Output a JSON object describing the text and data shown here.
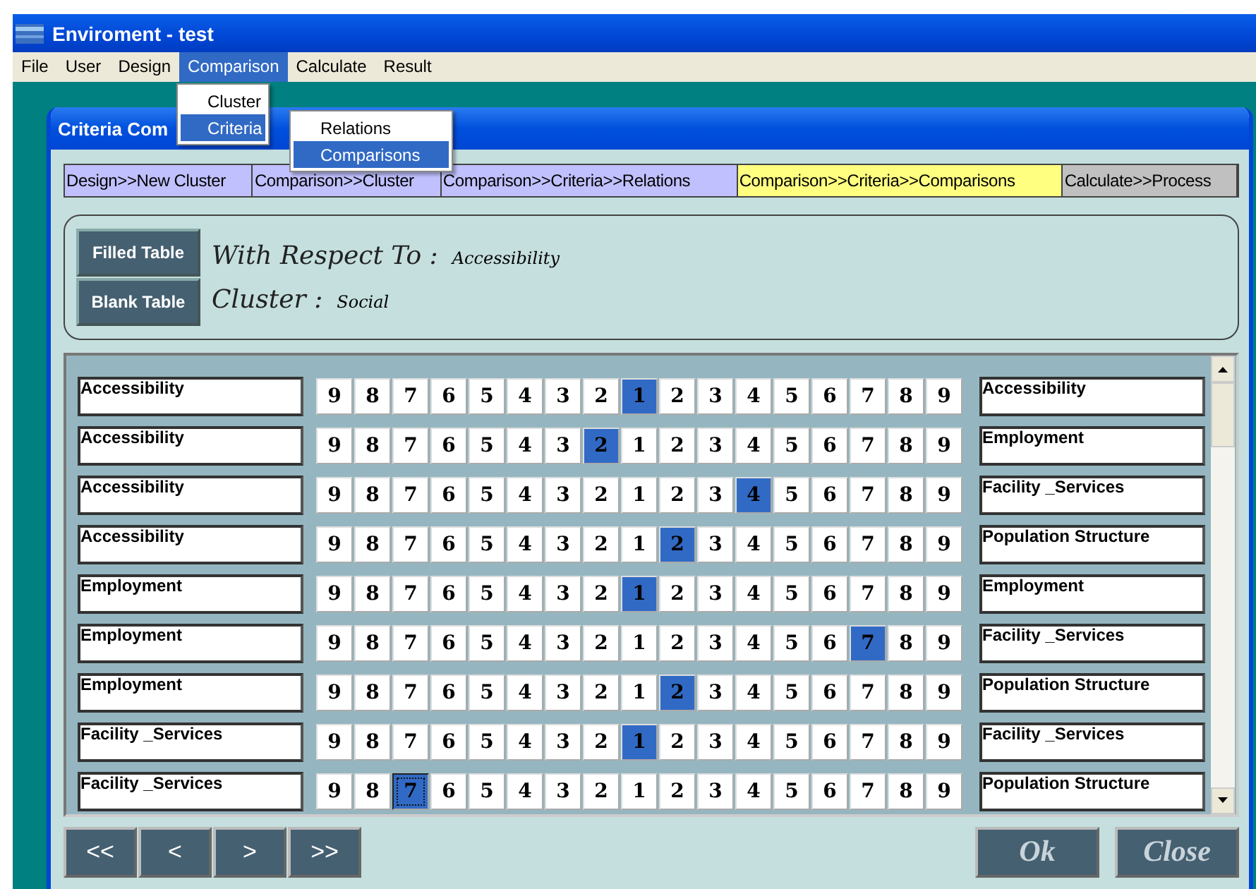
{
  "window": {
    "title": "Enviroment - test"
  },
  "menu": [
    {
      "label": "File",
      "selected": false
    },
    {
      "label": "User",
      "selected": false
    },
    {
      "label": "Design",
      "selected": false
    },
    {
      "label": "Comparison",
      "selected": true
    },
    {
      "label": "Calculate",
      "selected": false
    },
    {
      "label": "Result",
      "selected": false
    }
  ],
  "dropdown": [
    {
      "label": "Cluster",
      "selected": false
    },
    {
      "label": "Criteria",
      "selected": true,
      "children": [
        {
          "label": "Relations",
          "selected": false
        },
        {
          "label": "Comparisons",
          "selected": true
        }
      ]
    }
  ],
  "dialog": {
    "title": "Criteria Com"
  },
  "breadcrumbs": [
    {
      "label": "Design>>New Cluster",
      "color": "#c0c0ff"
    },
    {
      "label": "Comparison>>Cluster",
      "color": "#c0c0ff"
    },
    {
      "label": "Comparison>>Criteria>>Relations",
      "color": "#c0c0ff"
    },
    {
      "label": "Comparison>>Criteria>>Comparisons",
      "color": "#ffff80"
    },
    {
      "label": "Calculate>>Process",
      "color": "#c0c0c0"
    }
  ],
  "header": {
    "buttons": [
      "Filled Table",
      "Blank Table"
    ],
    "respect_label": "With Respect To :",
    "respect_value": "Accessibility",
    "cluster_label": "Cluster :",
    "cluster_value": "Social"
  },
  "rows": [
    {
      "left": "Accessibility",
      "right": "Accessibility",
      "focused": false,
      "cells": [
        {
          "label": "9",
          "selected": false
        },
        {
          "label": "8",
          "selected": false
        },
        {
          "label": "7",
          "selected": false
        },
        {
          "label": "6",
          "selected": false
        },
        {
          "label": "5",
          "selected": false
        },
        {
          "label": "4",
          "selected": false
        },
        {
          "label": "3",
          "selected": false
        },
        {
          "label": "2",
          "selected": false
        },
        {
          "label": "1",
          "selected": true
        },
        {
          "label": "2",
          "selected": false
        },
        {
          "label": "3",
          "selected": false
        },
        {
          "label": "4",
          "selected": false
        },
        {
          "label": "5",
          "selected": false
        },
        {
          "label": "6",
          "selected": false
        },
        {
          "label": "7",
          "selected": false
        },
        {
          "label": "8",
          "selected": false
        },
        {
          "label": "9",
          "selected": false
        }
      ]
    },
    {
      "left": "Accessibility",
      "right": "Employment",
      "focused": false,
      "cells": [
        {
          "label": "9",
          "selected": false
        },
        {
          "label": "8",
          "selected": false
        },
        {
          "label": "7",
          "selected": false
        },
        {
          "label": "6",
          "selected": false
        },
        {
          "label": "5",
          "selected": false
        },
        {
          "label": "4",
          "selected": false
        },
        {
          "label": "3",
          "selected": false
        },
        {
          "label": "2",
          "selected": true
        },
        {
          "label": "1",
          "selected": false
        },
        {
          "label": "2",
          "selected": false
        },
        {
          "label": "3",
          "selected": false
        },
        {
          "label": "4",
          "selected": false
        },
        {
          "label": "5",
          "selected": false
        },
        {
          "label": "6",
          "selected": false
        },
        {
          "label": "7",
          "selected": false
        },
        {
          "label": "8",
          "selected": false
        },
        {
          "label": "9",
          "selected": false
        }
      ]
    },
    {
      "left": "Accessibility",
      "right": "Facility _Services",
      "focused": false,
      "cells": [
        {
          "label": "9",
          "selected": false
        },
        {
          "label": "8",
          "selected": false
        },
        {
          "label": "7",
          "selected": false
        },
        {
          "label": "6",
          "selected": false
        },
        {
          "label": "5",
          "selected": false
        },
        {
          "label": "4",
          "selected": false
        },
        {
          "label": "3",
          "selected": false
        },
        {
          "label": "2",
          "selected": false
        },
        {
          "label": "1",
          "selected": false
        },
        {
          "label": "2",
          "selected": false
        },
        {
          "label": "3",
          "selected": false
        },
        {
          "label": "4",
          "selected": true
        },
        {
          "label": "5",
          "selected": false
        },
        {
          "label": "6",
          "selected": false
        },
        {
          "label": "7",
          "selected": false
        },
        {
          "label": "8",
          "selected": false
        },
        {
          "label": "9",
          "selected": false
        }
      ]
    },
    {
      "left": "Accessibility",
      "right": "Population Structure",
      "focused": false,
      "cells": [
        {
          "label": "9",
          "selected": false
        },
        {
          "label": "8",
          "selected": false
        },
        {
          "label": "7",
          "selected": false
        },
        {
          "label": "6",
          "selected": false
        },
        {
          "label": "5",
          "selected": false
        },
        {
          "label": "4",
          "selected": false
        },
        {
          "label": "3",
          "selected": false
        },
        {
          "label": "2",
          "selected": false
        },
        {
          "label": "1",
          "selected": false
        },
        {
          "label": "2",
          "selected": true
        },
        {
          "label": "3",
          "selected": false
        },
        {
          "label": "4",
          "selected": false
        },
        {
          "label": "5",
          "selected": false
        },
        {
          "label": "6",
          "selected": false
        },
        {
          "label": "7",
          "selected": false
        },
        {
          "label": "8",
          "selected": false
        },
        {
          "label": "9",
          "selected": false
        }
      ]
    },
    {
      "left": "Employment",
      "right": "Employment",
      "focused": false,
      "cells": [
        {
          "label": "9",
          "selected": false
        },
        {
          "label": "8",
          "selected": false
        },
        {
          "label": "7",
          "selected": false
        },
        {
          "label": "6",
          "selected": false
        },
        {
          "label": "5",
          "selected": false
        },
        {
          "label": "4",
          "selected": false
        },
        {
          "label": "3",
          "selected": false
        },
        {
          "label": "2",
          "selected": false
        },
        {
          "label": "1",
          "selected": true
        },
        {
          "label": "2",
          "selected": false
        },
        {
          "label": "3",
          "selected": false
        },
        {
          "label": "4",
          "selected": false
        },
        {
          "label": "5",
          "selected": false
        },
        {
          "label": "6",
          "selected": false
        },
        {
          "label": "7",
          "selected": false
        },
        {
          "label": "8",
          "selected": false
        },
        {
          "label": "9",
          "selected": false
        }
      ]
    },
    {
      "left": "Employment",
      "right": "Facility _Services",
      "focused": false,
      "cells": [
        {
          "label": "9",
          "selected": false
        },
        {
          "label": "8",
          "selected": false
        },
        {
          "label": "7",
          "selected": false
        },
        {
          "label": "6",
          "selected": false
        },
        {
          "label": "5",
          "selected": false
        },
        {
          "label": "4",
          "selected": false
        },
        {
          "label": "3",
          "selected": false
        },
        {
          "label": "2",
          "selected": false
        },
        {
          "label": "1",
          "selected": false
        },
        {
          "label": "2",
          "selected": false
        },
        {
          "label": "3",
          "selected": false
        },
        {
          "label": "4",
          "selected": false
        },
        {
          "label": "5",
          "selected": false
        },
        {
          "label": "6",
          "selected": false
        },
        {
          "label": "7",
          "selected": true
        },
        {
          "label": "8",
          "selected": false
        },
        {
          "label": "9",
          "selected": false
        }
      ]
    },
    {
      "left": "Employment",
      "right": "Population Structure",
      "focused": false,
      "cells": [
        {
          "label": "9",
          "selected": false
        },
        {
          "label": "8",
          "selected": false
        },
        {
          "label": "7",
          "selected": false
        },
        {
          "label": "6",
          "selected": false
        },
        {
          "label": "5",
          "selected": false
        },
        {
          "label": "4",
          "selected": false
        },
        {
          "label": "3",
          "selected": false
        },
        {
          "label": "2",
          "selected": false
        },
        {
          "label": "1",
          "selected": false
        },
        {
          "label": "2",
          "selected": true
        },
        {
          "label": "3",
          "selected": false
        },
        {
          "label": "4",
          "selected": false
        },
        {
          "label": "5",
          "selected": false
        },
        {
          "label": "6",
          "selected": false
        },
        {
          "label": "7",
          "selected": false
        },
        {
          "label": "8",
          "selected": false
        },
        {
          "label": "9",
          "selected": false
        }
      ]
    },
    {
      "left": "Facility _Services",
      "right": "Facility _Services",
      "focused": false,
      "cells": [
        {
          "label": "9",
          "selected": false
        },
        {
          "label": "8",
          "selected": false
        },
        {
          "label": "7",
          "selected": false
        },
        {
          "label": "6",
          "selected": false
        },
        {
          "label": "5",
          "selected": false
        },
        {
          "label": "4",
          "selected": false
        },
        {
          "label": "3",
          "selected": false
        },
        {
          "label": "2",
          "selected": false
        },
        {
          "label": "1",
          "selected": true
        },
        {
          "label": "2",
          "selected": false
        },
        {
          "label": "3",
          "selected": false
        },
        {
          "label": "4",
          "selected": false
        },
        {
          "label": "5",
          "selected": false
        },
        {
          "label": "6",
          "selected": false
        },
        {
          "label": "7",
          "selected": false
        },
        {
          "label": "8",
          "selected": false
        },
        {
          "label": "9",
          "selected": false
        }
      ]
    },
    {
      "left": "Facility _Services",
      "right": "Population Structure",
      "focused": true,
      "cells": [
        {
          "label": "9",
          "selected": false
        },
        {
          "label": "8",
          "selected": false
        },
        {
          "label": "7",
          "selected": true
        },
        {
          "label": "6",
          "selected": false
        },
        {
          "label": "5",
          "selected": false
        },
        {
          "label": "4",
          "selected": false
        },
        {
          "label": "3",
          "selected": false
        },
        {
          "label": "2",
          "selected": false
        },
        {
          "label": "1",
          "selected": false
        },
        {
          "label": "2",
          "selected": false
        },
        {
          "label": "3",
          "selected": false
        },
        {
          "label": "4",
          "selected": false
        },
        {
          "label": "5",
          "selected": false
        },
        {
          "label": "6",
          "selected": false
        },
        {
          "label": "7",
          "selected": false
        },
        {
          "label": "8",
          "selected": false
        },
        {
          "label": "9",
          "selected": false
        }
      ]
    }
  ],
  "nav_buttons": [
    "<<",
    "<",
    ">",
    ">>"
  ],
  "actions": [
    "Ok",
    "Close"
  ]
}
